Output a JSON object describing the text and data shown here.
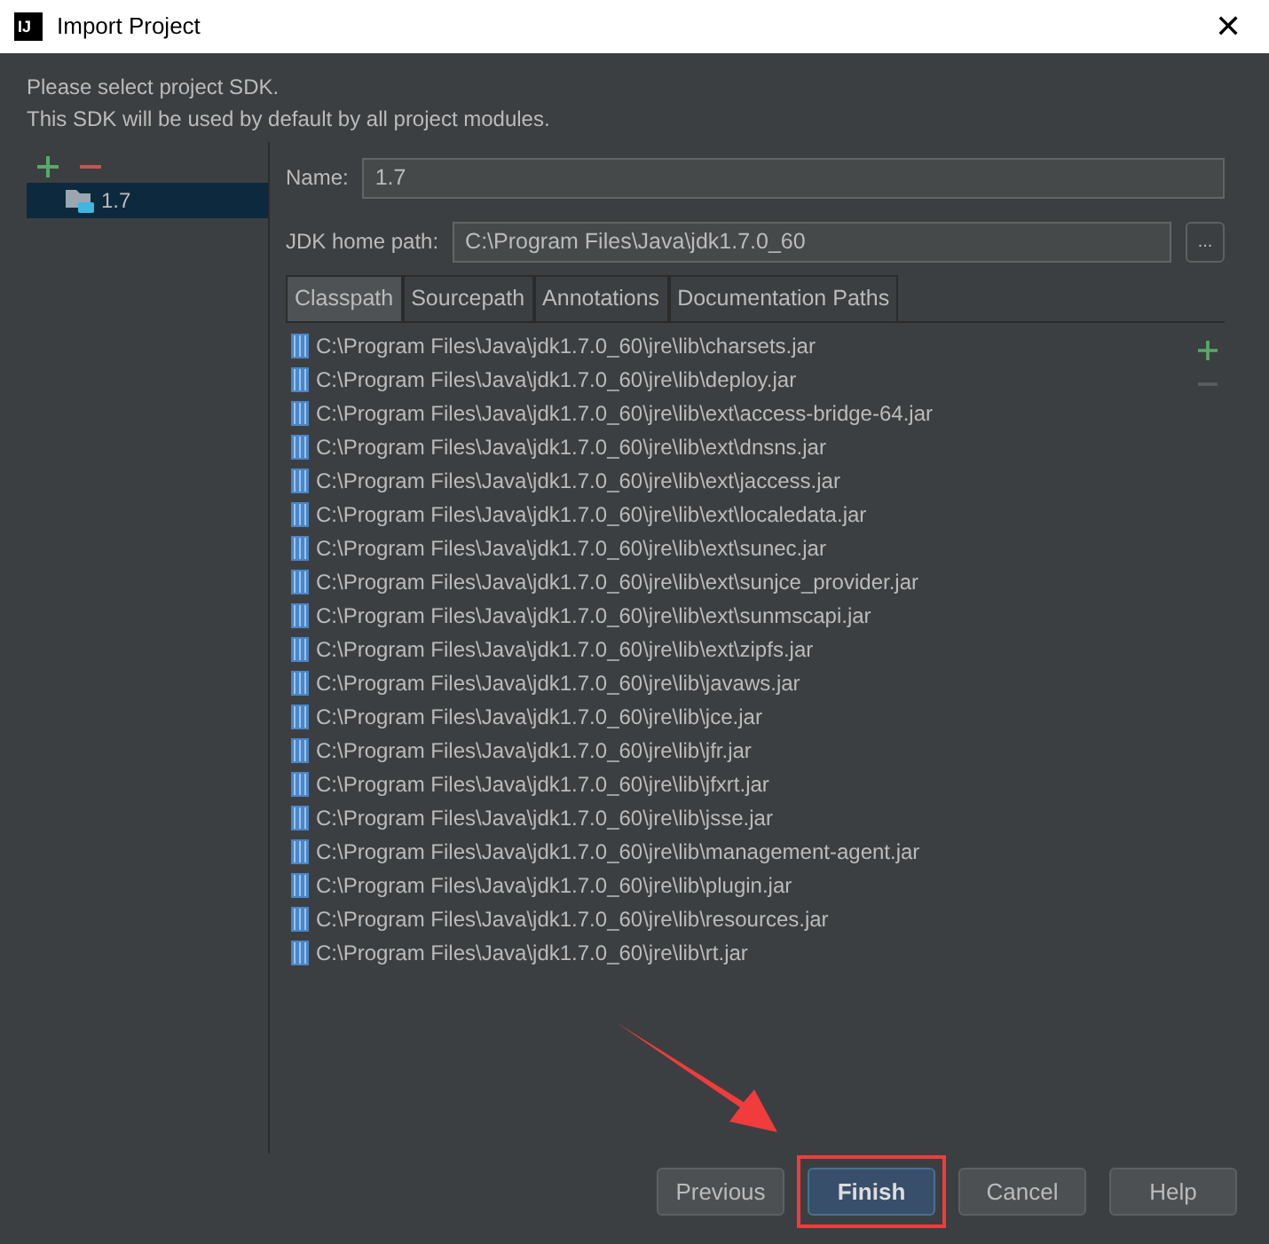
{
  "window": {
    "title": "Import Project",
    "logo": "IJ",
    "close": "✕"
  },
  "intro": [
    "Please select project SDK.",
    "This SDK will be used by default by all project modules."
  ],
  "sdk_list": [
    {
      "label": "1.7",
      "selected": true
    }
  ],
  "name_field": {
    "label": "Name:",
    "value": "1.7"
  },
  "jdk_home": {
    "label": "JDK home path:",
    "value": "C:\\Program Files\\Java\\jdk1.7.0_60",
    "browse": "..."
  },
  "tabs": [
    {
      "label": "Classpath",
      "selected": true
    },
    {
      "label": "Sourcepath",
      "selected": false
    },
    {
      "label": "Annotations",
      "selected": false
    },
    {
      "label": "Documentation Paths",
      "selected": false
    }
  ],
  "classpath": [
    "C:\\Program Files\\Java\\jdk1.7.0_60\\jre\\lib\\charsets.jar",
    "C:\\Program Files\\Java\\jdk1.7.0_60\\jre\\lib\\deploy.jar",
    "C:\\Program Files\\Java\\jdk1.7.0_60\\jre\\lib\\ext\\access-bridge-64.jar",
    "C:\\Program Files\\Java\\jdk1.7.0_60\\jre\\lib\\ext\\dnsns.jar",
    "C:\\Program Files\\Java\\jdk1.7.0_60\\jre\\lib\\ext\\jaccess.jar",
    "C:\\Program Files\\Java\\jdk1.7.0_60\\jre\\lib\\ext\\localedata.jar",
    "C:\\Program Files\\Java\\jdk1.7.0_60\\jre\\lib\\ext\\sunec.jar",
    "C:\\Program Files\\Java\\jdk1.7.0_60\\jre\\lib\\ext\\sunjce_provider.jar",
    "C:\\Program Files\\Java\\jdk1.7.0_60\\jre\\lib\\ext\\sunmscapi.jar",
    "C:\\Program Files\\Java\\jdk1.7.0_60\\jre\\lib\\ext\\zipfs.jar",
    "C:\\Program Files\\Java\\jdk1.7.0_60\\jre\\lib\\javaws.jar",
    "C:\\Program Files\\Java\\jdk1.7.0_60\\jre\\lib\\jce.jar",
    "C:\\Program Files\\Java\\jdk1.7.0_60\\jre\\lib\\jfr.jar",
    "C:\\Program Files\\Java\\jdk1.7.0_60\\jre\\lib\\jfxrt.jar",
    "C:\\Program Files\\Java\\jdk1.7.0_60\\jre\\lib\\jsse.jar",
    "C:\\Program Files\\Java\\jdk1.7.0_60\\jre\\lib\\management-agent.jar",
    "C:\\Program Files\\Java\\jdk1.7.0_60\\jre\\lib\\plugin.jar",
    "C:\\Program Files\\Java\\jdk1.7.0_60\\jre\\lib\\resources.jar",
    "C:\\Program Files\\Java\\jdk1.7.0_60\\jre\\lib\\rt.jar"
  ],
  "buttons": [
    {
      "label": "Previous",
      "default": false,
      "highlighted": false
    },
    {
      "label": "Finish",
      "default": true,
      "highlighted": true
    },
    {
      "label": "Cancel",
      "default": false,
      "highlighted": false
    },
    {
      "label": "Help",
      "default": false,
      "highlighted": false
    }
  ],
  "pointer_arrow": true
}
